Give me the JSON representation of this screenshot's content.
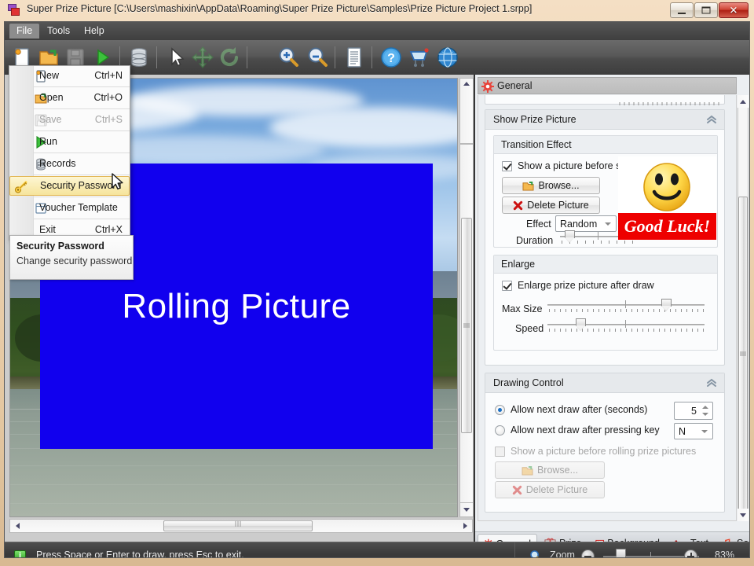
{
  "window": {
    "title": "Super Prize Picture [C:\\Users\\mashixin\\AppData\\Roaming\\Super Prize Picture\\Samples\\Prize Picture Project 1.srpp]",
    "app_icon": "app-logo-icon",
    "minimize_label": "",
    "maximize_label": "",
    "close_label": "✕"
  },
  "menubar": {
    "items": [
      {
        "label": "File",
        "active": true
      },
      {
        "label": "Tools",
        "active": false
      },
      {
        "label": "Help",
        "active": false
      }
    ]
  },
  "toolbar": {
    "buttons": [
      {
        "name": "new-document-icon",
        "title": "New"
      },
      {
        "name": "open-folder-icon",
        "title": "Open"
      },
      {
        "name": "save-disk-icon",
        "title": "Save"
      },
      {
        "name": "run-play-icon",
        "title": "Run"
      },
      {
        "name": "records-database-icon",
        "title": "Records"
      },
      {
        "name": "select-pointer-icon",
        "title": "Select"
      },
      {
        "name": "move-arrows-icon",
        "title": "Move"
      },
      {
        "name": "rotate-icon",
        "title": "Rotate"
      },
      {
        "name": "zoom-in-icon",
        "title": "Zoom In"
      },
      {
        "name": "zoom-out-icon",
        "title": "Zoom Out"
      },
      {
        "name": "page-icon",
        "title": "Page"
      },
      {
        "name": "help-question-icon",
        "title": "Help"
      },
      {
        "name": "cart-icon",
        "title": "Buy"
      },
      {
        "name": "globe-icon",
        "title": "Website"
      }
    ]
  },
  "file_menu": {
    "items": [
      {
        "label": "New",
        "shortcut": "Ctrl+N",
        "icon": "new-document-icon",
        "disabled": false,
        "highlighted": false
      },
      {
        "label": "Open",
        "shortcut": "Ctrl+O",
        "icon": "open-folder-icon",
        "disabled": false,
        "highlighted": false
      },
      {
        "label": "Save",
        "shortcut": "Ctrl+S",
        "icon": "save-disk-icon",
        "disabled": true,
        "highlighted": false
      },
      {
        "label": "Run",
        "shortcut": "",
        "icon": "run-play-icon",
        "disabled": false,
        "highlighted": false
      },
      {
        "label": "Records",
        "shortcut": "",
        "icon": "records-database-icon",
        "disabled": false,
        "highlighted": false
      },
      {
        "label": "Security Password",
        "shortcut": "",
        "icon": "key-icon",
        "disabled": false,
        "highlighted": true
      },
      {
        "label": "Voucher Template",
        "shortcut": "",
        "icon": "template-icon",
        "disabled": false,
        "highlighted": false
      },
      {
        "label": "Exit",
        "shortcut": "Ctrl+X",
        "icon": "",
        "disabled": false,
        "highlighted": false
      }
    ]
  },
  "tooltip": {
    "title": "Security Password",
    "description": "Change security password"
  },
  "canvas": {
    "rolling_label": "Rolling Picture",
    "rolling_color": "#1100ee"
  },
  "panel": {
    "header": {
      "title": "General",
      "icon": "gear-icon"
    },
    "show_prize_picture": {
      "title": "Show Prize Picture",
      "collapse_icon": "chevron-up-icon",
      "transition_effect": {
        "title": "Transition Effect",
        "checkbox_label": "Show a picture before showing prize picture",
        "checkbox_checked": true,
        "browse_label": "Browse...",
        "browse_icon": "open-folder-icon",
        "delete_label": "Delete Picture",
        "delete_icon": "red-x-icon",
        "effect_label": "Effect",
        "effect_value": "Random",
        "duration_label": "Duration",
        "duration_percent": 12,
        "preview_image": "smiley-face-icon",
        "preview_caption": "Good Luck!",
        "preview_caption_bg": "#ee0000"
      },
      "enlarge": {
        "title": "Enlarge",
        "checkbox_label": "Enlarge prize picture after draw",
        "checkbox_checked": true,
        "max_size_label": "Max Size",
        "max_size_percent": 76,
        "speed_label": "Speed",
        "speed_percent": 19
      }
    },
    "drawing_control": {
      "title": "Drawing Control",
      "collapse_icon": "chevron-up-icon",
      "radio_seconds_label": "Allow next draw after (seconds)",
      "radio_seconds_selected": true,
      "seconds_value": "5",
      "radio_key_label": "Allow next draw after pressing key",
      "radio_key_selected": false,
      "key_value": "N",
      "show_before_rolling_label": "Show a picture before rolling prize pictures",
      "show_before_rolling_checked": false,
      "show_before_rolling_disabled": true,
      "browse_label": "Browse...",
      "browse_disabled": true,
      "delete_label": "Delete Picture",
      "delete_disabled": true
    }
  },
  "tabs": [
    {
      "label": "General",
      "icon": "gear-icon",
      "active": true
    },
    {
      "label": "Prize",
      "icon": "gift-icon",
      "active": false
    },
    {
      "label": "Background",
      "icon": "image-icon",
      "active": false
    },
    {
      "label": "Text",
      "icon": "font-aa-icon",
      "active": false
    },
    {
      "label": "Sound",
      "icon": "music-note-icon",
      "active": false
    }
  ],
  "statusbar": {
    "icon": "info-icon",
    "icon_glyph": "i",
    "message": "Press Space or Enter to draw, press Esc to exit.",
    "zoom_icon": "magnifier-icon",
    "zoom_label": "Zoom",
    "zoom_out_label": "−",
    "zoom_in_label": "+",
    "zoom_percent": "83%",
    "zoom_value": 83
  }
}
